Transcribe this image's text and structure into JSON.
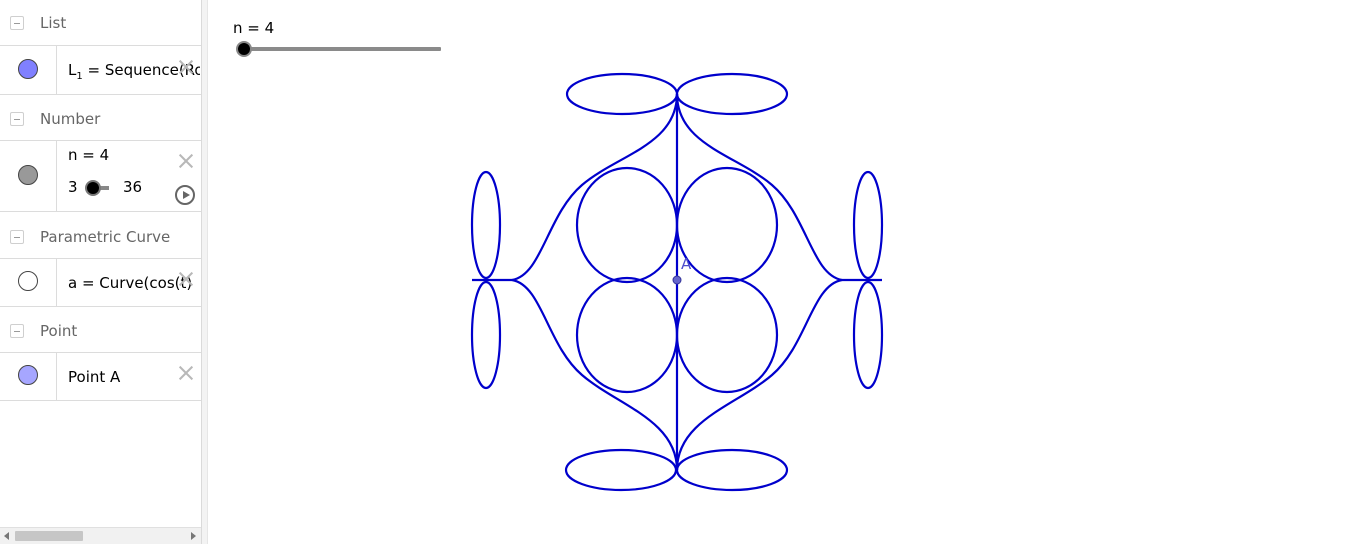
{
  "algebra": {
    "groups": [
      {
        "label": "List",
        "item": {
          "text_main": "L",
          "text_sub": "1",
          "text_rest": " = Sequence(Ro",
          "marble_color": "#8080ff",
          "marble_filled": true
        }
      },
      {
        "label": "Number",
        "item": {
          "text": "n = 4",
          "slider_min": "3",
          "slider_max": "36",
          "marble_color": "#999999",
          "marble_filled": true
        }
      },
      {
        "label": "Parametric Curve",
        "item": {
          "text": "a = Curve(cos(t)",
          "marble_color": "#ffffff",
          "marble_filled": false
        }
      },
      {
        "label": "Point",
        "item": {
          "text": "Point A",
          "marble_color": "#a6a6ff",
          "marble_filled": true
        }
      }
    ]
  },
  "graphics": {
    "slider_label": "n = 4",
    "slider": {
      "min": 3,
      "max": 36,
      "value": 4
    },
    "point_label": "A",
    "curve_color": "#0000cc",
    "point_color": "#6666cc",
    "icons": [
      "collapse-icon",
      "close-icon",
      "play-icon"
    ]
  }
}
